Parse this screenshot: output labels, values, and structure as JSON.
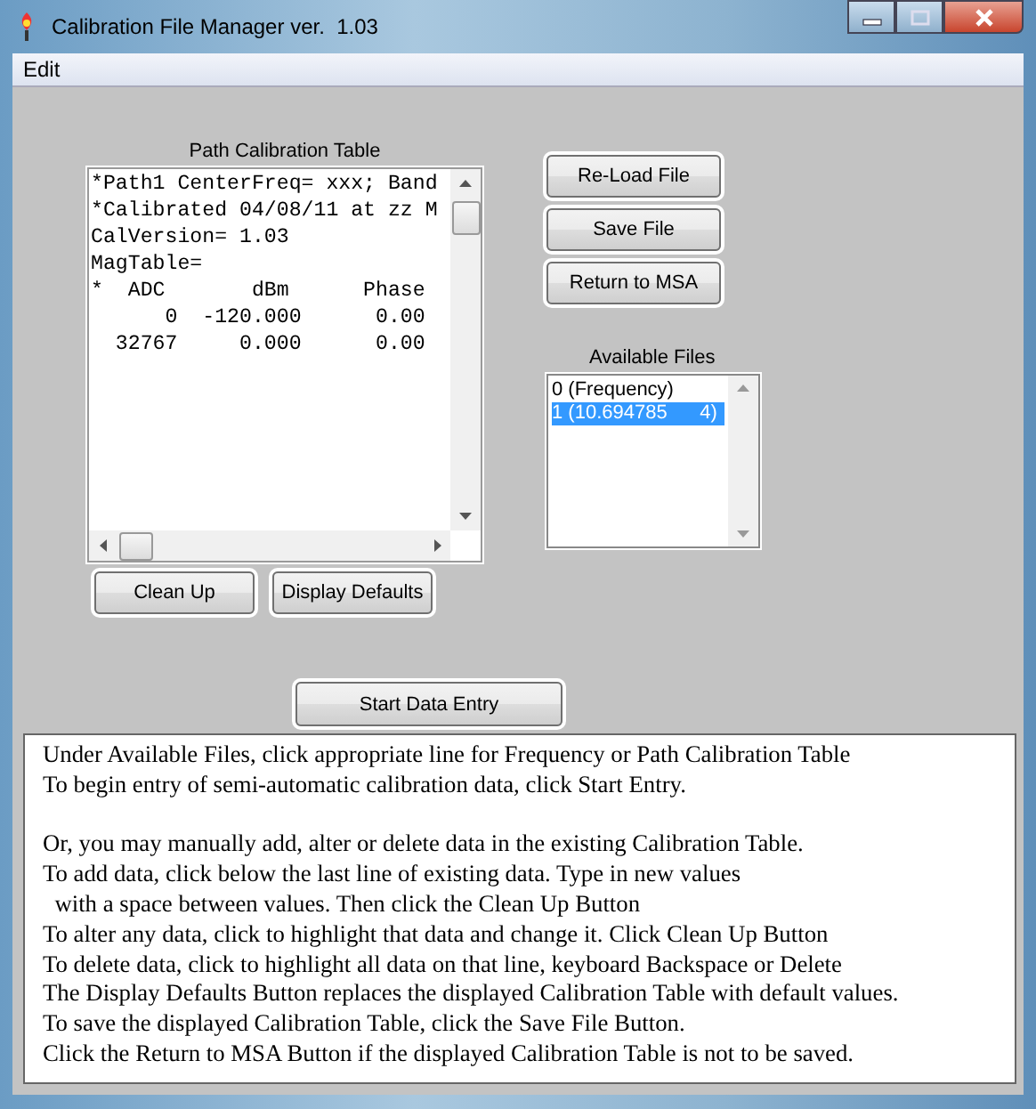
{
  "window": {
    "title": "Calibration File Manager ver.  1.03"
  },
  "menu": [
    {
      "label": "Edit"
    }
  ],
  "calibration_table": {
    "label": "Path Calibration Table",
    "lines": [
      "*Path1 CenterFreq= xxx; Band",
      "*Calibrated 04/08/11 at zz M",
      "CalVersion= 1.03",
      "MagTable=",
      "*  ADC       dBm      Phase",
      "      0  -120.000      0.00",
      "  32767     0.000      0.00"
    ]
  },
  "table_buttons": [
    "Clean Up",
    "Display Defaults"
  ],
  "file_buttons": [
    "Re-Load File",
    "Save File",
    "Return to MSA"
  ],
  "available_files": {
    "label": "Available Files",
    "items": [
      {
        "label": "0 (Frequency)",
        "selected": false
      },
      {
        "label": "1 (10.694785      4)",
        "selected": true
      }
    ]
  },
  "start_button": "Start Data Entry",
  "instructions": [
    [
      "Under Available Files, click appropriate line for Frequency or Path Calibration Table",
      "To begin entry of semi-automatic calibration data, click Start Entry."
    ],
    [
      "Or, you may manually add, alter or delete data in the existing Calibration Table.",
      "To add data, click below the last line of existing data. Type in new values",
      "  with a space between values. Then click the Clean Up Button",
      "To alter any data, click to highlight that data and change it. Click Clean Up Button",
      "To delete data, click to highlight all data on that line, keyboard Backspace or Delete",
      "The Display Defaults Button replaces the displayed Calibration Table with default values.",
      "To save the displayed Calibration Table, click the Save File Button.",
      "Click the Return to MSA Button if the displayed Calibration Table is not to be saved."
    ]
  ]
}
